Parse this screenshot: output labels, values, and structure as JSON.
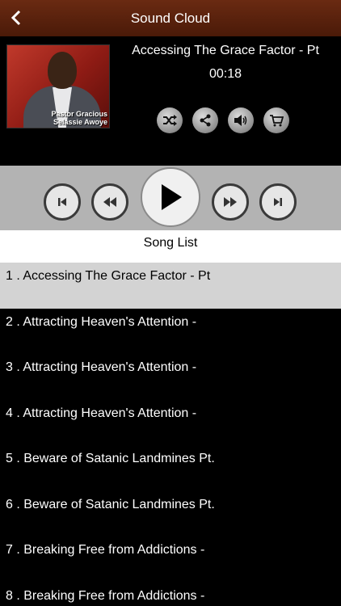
{
  "header": {
    "title": "Sound Cloud",
    "back_icon": "chevron-left-icon"
  },
  "now_playing": {
    "art_caption_line1": "Pastor Gracious",
    "art_caption_line2": "Selassie Awoye",
    "title": "Accessing The Grace Factor - Pt",
    "time": "00:18"
  },
  "tools": [
    "shuffle-icon",
    "share-icon",
    "volume-icon",
    "cart-icon"
  ],
  "controls": [
    "skip-previous-icon",
    "rewind-icon",
    "play-icon",
    "fast-forward-icon",
    "skip-next-icon"
  ],
  "song_list": {
    "header": "Song List",
    "selected_index": 0,
    "items": [
      "1 . Accessing The Grace Factor - Pt",
      "2 . Attracting Heaven's Attention -",
      "3 . Attracting Heaven's Attention -",
      "4 . Attracting Heaven's Attention -",
      "5 . Beware of Satanic Landmines Pt.",
      "6 . Beware of Satanic Landmines Pt.",
      "7 . Breaking Free from Addictions -",
      "8 . Breaking Free from Addictions -"
    ]
  },
  "colors": {
    "header_bg": "#5a2210",
    "controls_bg": "#b3b3b3",
    "selected_row": "#d3d3d3"
  }
}
